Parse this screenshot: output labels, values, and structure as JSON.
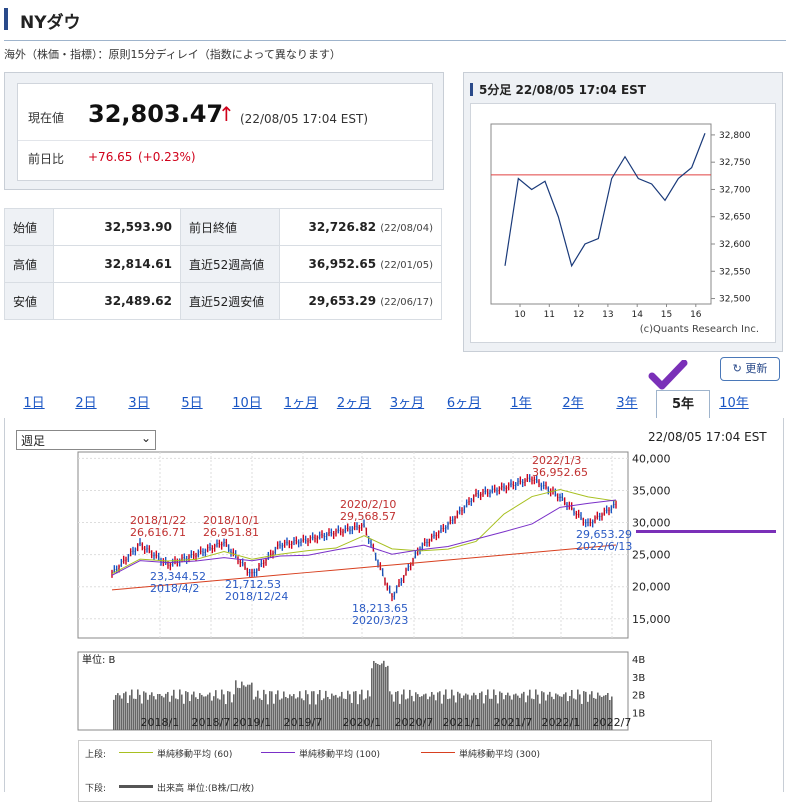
{
  "page": {
    "title": "NYダウ",
    "note": "海外（株価・指標）：原則15分ディレイ（指数によって異なります）"
  },
  "quote": {
    "label_current": "現在値",
    "current": "32,803.47",
    "arrow": "↑",
    "timestamp": "(22/08/05 17:04 EST)",
    "label_change": "前日比",
    "change": "+76.65",
    "change_pct": "(+0.23%)"
  },
  "stats": [
    {
      "label": "始値",
      "value": "32,593.90",
      "label2": "前日終値",
      "value2": "32,726.82",
      "date2": "(22/08/04)"
    },
    {
      "label": "高値",
      "value": "32,814.61",
      "label2": "直近52週高値",
      "value2": "36,952.65",
      "date2": "(22/01/05)"
    },
    {
      "label": "安値",
      "value": "32,489.62",
      "label2": "直近52週安値",
      "value2": "29,653.29",
      "date2": "(22/06/17)"
    }
  ],
  "mini_chart": {
    "title": "5分足 22/08/05 17:04 EST",
    "credit": "(c)Quants Research Inc.",
    "y_ticks": [
      "32,800",
      "32,750",
      "32,700",
      "32,650",
      "32,600",
      "32,550",
      "32,500"
    ],
    "x_ticks": [
      "10",
      "11",
      "12",
      "13",
      "14",
      "15",
      "16"
    ],
    "ref_level": 32726.82,
    "color": "#1a3a7a"
  },
  "refresh_label": "更新",
  "tabs": [
    "1日",
    "2日",
    "3日",
    "5日",
    "10日",
    "1ヶ月",
    "2ヶ月",
    "3ヶ月",
    "6ヶ月",
    "1年",
    "2年",
    "3年",
    "5年",
    "10年"
  ],
  "active_tab": "5年",
  "period_select": "週足",
  "chart_timestamp": "22/08/05 17:04 EST",
  "main_chart": {
    "y_ticks": [
      "40,000",
      "35,000",
      "30,000",
      "25,000",
      "20,000",
      "15,000"
    ],
    "x_ticks": [
      "2018/1",
      "2018/7",
      "2019/1",
      "2019/7",
      "2020/1",
      "2020/7",
      "2021/1",
      "2021/7",
      "2022/1",
      "2022/7"
    ],
    "annotations": [
      {
        "date": "2018/1/22",
        "value": "26,616.71",
        "kind": "high"
      },
      {
        "date": "2018/10/1",
        "value": "26,951.81",
        "kind": "high"
      },
      {
        "date": "2020/2/10",
        "value": "29,568.57",
        "kind": "high"
      },
      {
        "date": "2022/1/3",
        "value": "36,952.65",
        "kind": "high"
      },
      {
        "date": "2018/4/2",
        "value": "23,344.52",
        "kind": "low"
      },
      {
        "date": "2018/12/24",
        "value": "21,712.53",
        "kind": "low"
      },
      {
        "date": "2020/3/23",
        "value": "18,213.65",
        "kind": "low"
      },
      {
        "date": "2022/6/13",
        "value": "29,653.29",
        "kind": "low"
      }
    ],
    "volume_unit": "単位: B",
    "volume_ticks": [
      "4B",
      "3B",
      "2B",
      "1B"
    ]
  },
  "legend": {
    "upper_label": "上段:",
    "ma60": "単純移動平均 (60)",
    "ma100": "単純移動平均 (100)",
    "ma300": "単純移動平均 (300)",
    "lower_label": "下段:",
    "volume": "出来高 単位:(B株/口/枚)"
  },
  "colors": {
    "up": "#d0021b",
    "down": "#1a56c4",
    "ma60": "#a8c020",
    "ma100": "#7a30c8",
    "ma300": "#d84020",
    "accent": "#2a4a8a"
  },
  "chart_data": [
    {
      "type": "line",
      "title": "5分足 22/08/05 17:04 EST",
      "x": [
        "9:35",
        "10:00",
        "10:15",
        "10:30",
        "11:00",
        "11:15",
        "11:30",
        "12:00",
        "12:30",
        "13:00",
        "13:30",
        "14:00",
        "14:30",
        "15:00",
        "15:30",
        "16:00"
      ],
      "series": [
        {
          "values": [
            32560,
            32720,
            32700,
            32715,
            32650,
            32560,
            32600,
            32610,
            32720,
            32760,
            32720,
            32710,
            32680,
            32720,
            32740,
            32803
          ]
        }
      ],
      "ylim": [
        32490,
        32820
      ]
    },
    {
      "type": "line",
      "x": [
        "2017/9",
        "2018/1",
        "2018/4",
        "2018/7",
        "2018/10",
        "2018/12",
        "2019/4",
        "2019/7",
        "2019/12",
        "2020/2",
        "2020/3",
        "2020/6",
        "2020/11",
        "2021/5",
        "2021/8",
        "2022/1",
        "2022/3",
        "2022/6",
        "2022/8"
      ],
      "series": [
        {
          "values": [
            22000,
            26600,
            23400,
            25000,
            26900,
            21800,
            26500,
            27300,
            28500,
            29500,
            18300,
            26000,
            29600,
            34300,
            35400,
            36900,
            34000,
            29700,
            32800
          ]
        }
      ],
      "ylim": [
        12000,
        41000
      ]
    }
  ]
}
